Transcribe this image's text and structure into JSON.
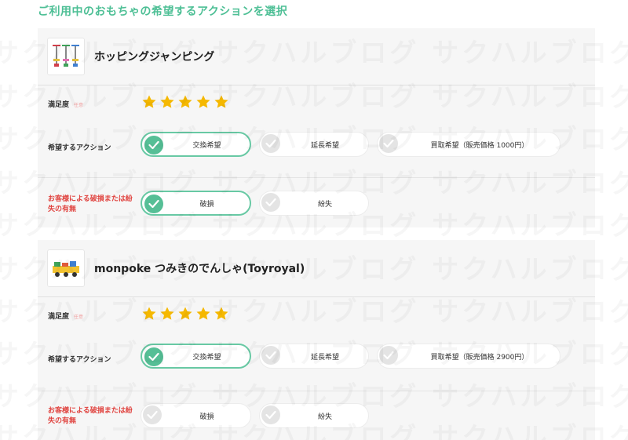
{
  "heading": "ご利用中のおもちゃの希望するアクションを選択",
  "watermark_text": "サクハルブログ サクハルブログ サクハルブログ サクハルブログ",
  "labels": {
    "satisfaction": "満足度",
    "optional": "任意",
    "action": "希望するアクション",
    "damage": "お客様による破損または紛失の有無"
  },
  "colors": {
    "accent": "#56bf96",
    "star": "#f5b800",
    "warning": "#e0433f"
  },
  "items": [
    {
      "product_name": "ホッピングジャンピング",
      "thumbnail_icon": "pogo-stick-icon",
      "rating": 5,
      "rating_max": 5,
      "actions": [
        {
          "label": "交換希望",
          "selected": true
        },
        {
          "label": "延長希望",
          "selected": false
        },
        {
          "label": "買取希望（販売価格 1000円）",
          "selected": false
        }
      ],
      "damage_options": [
        {
          "label": "破損",
          "selected": true
        },
        {
          "label": "紛失",
          "selected": false
        }
      ]
    },
    {
      "product_name": "monpoke つみきのでんしゃ(Toyroyal)",
      "thumbnail_icon": "toy-train-icon",
      "rating": 5,
      "rating_max": 5,
      "actions": [
        {
          "label": "交換希望",
          "selected": true
        },
        {
          "label": "延長希望",
          "selected": false
        },
        {
          "label": "買取希望（販売価格 2900円）",
          "selected": false
        }
      ],
      "damage_options": [
        {
          "label": "破損",
          "selected": false
        },
        {
          "label": "紛失",
          "selected": false
        }
      ]
    }
  ]
}
